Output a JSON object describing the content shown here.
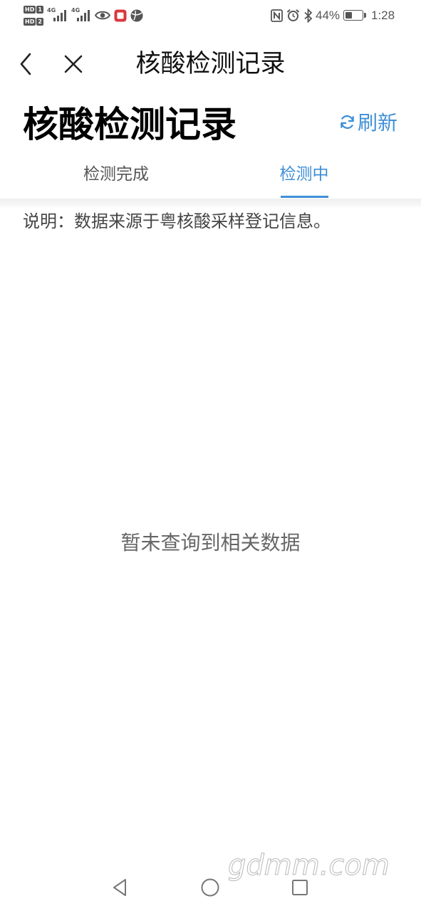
{
  "status_bar": {
    "hd_badges": [
      {
        "label": "HD",
        "index": "1"
      },
      {
        "label": "HD",
        "index": "2"
      }
    ],
    "network_labels": [
      "4G",
      "4G"
    ],
    "icons": [
      "hd-icon",
      "signal-icon",
      "signal-icon",
      "eye-icon",
      "app-notification-icon",
      "globe-icon",
      "nfc-icon",
      "alarm-icon",
      "bluetooth-icon",
      "battery-icon"
    ],
    "battery_percent": "44%",
    "time": "1:28"
  },
  "nav": {
    "title": "核酸检测记录",
    "back_icon": "chevron-left-icon",
    "close_icon": "close-icon"
  },
  "header": {
    "title": "核酸检测记录",
    "refresh_label": "刷新",
    "refresh_icon": "refresh-icon"
  },
  "tabs": [
    {
      "label": "检测完成",
      "active": false
    },
    {
      "label": "检测中",
      "active": true
    }
  ],
  "note": "说明：数据来源于粤核酸采样登记信息。",
  "empty_state": "暂未查询到相关数据",
  "watermark": "gdmm.com",
  "system_nav": [
    "back-triangle-icon",
    "home-circle-icon",
    "recents-square-icon"
  ],
  "colors": {
    "accent": "#3f8fd6",
    "text_primary": "#111111",
    "text_secondary": "#555555",
    "background": "#ffffff"
  }
}
